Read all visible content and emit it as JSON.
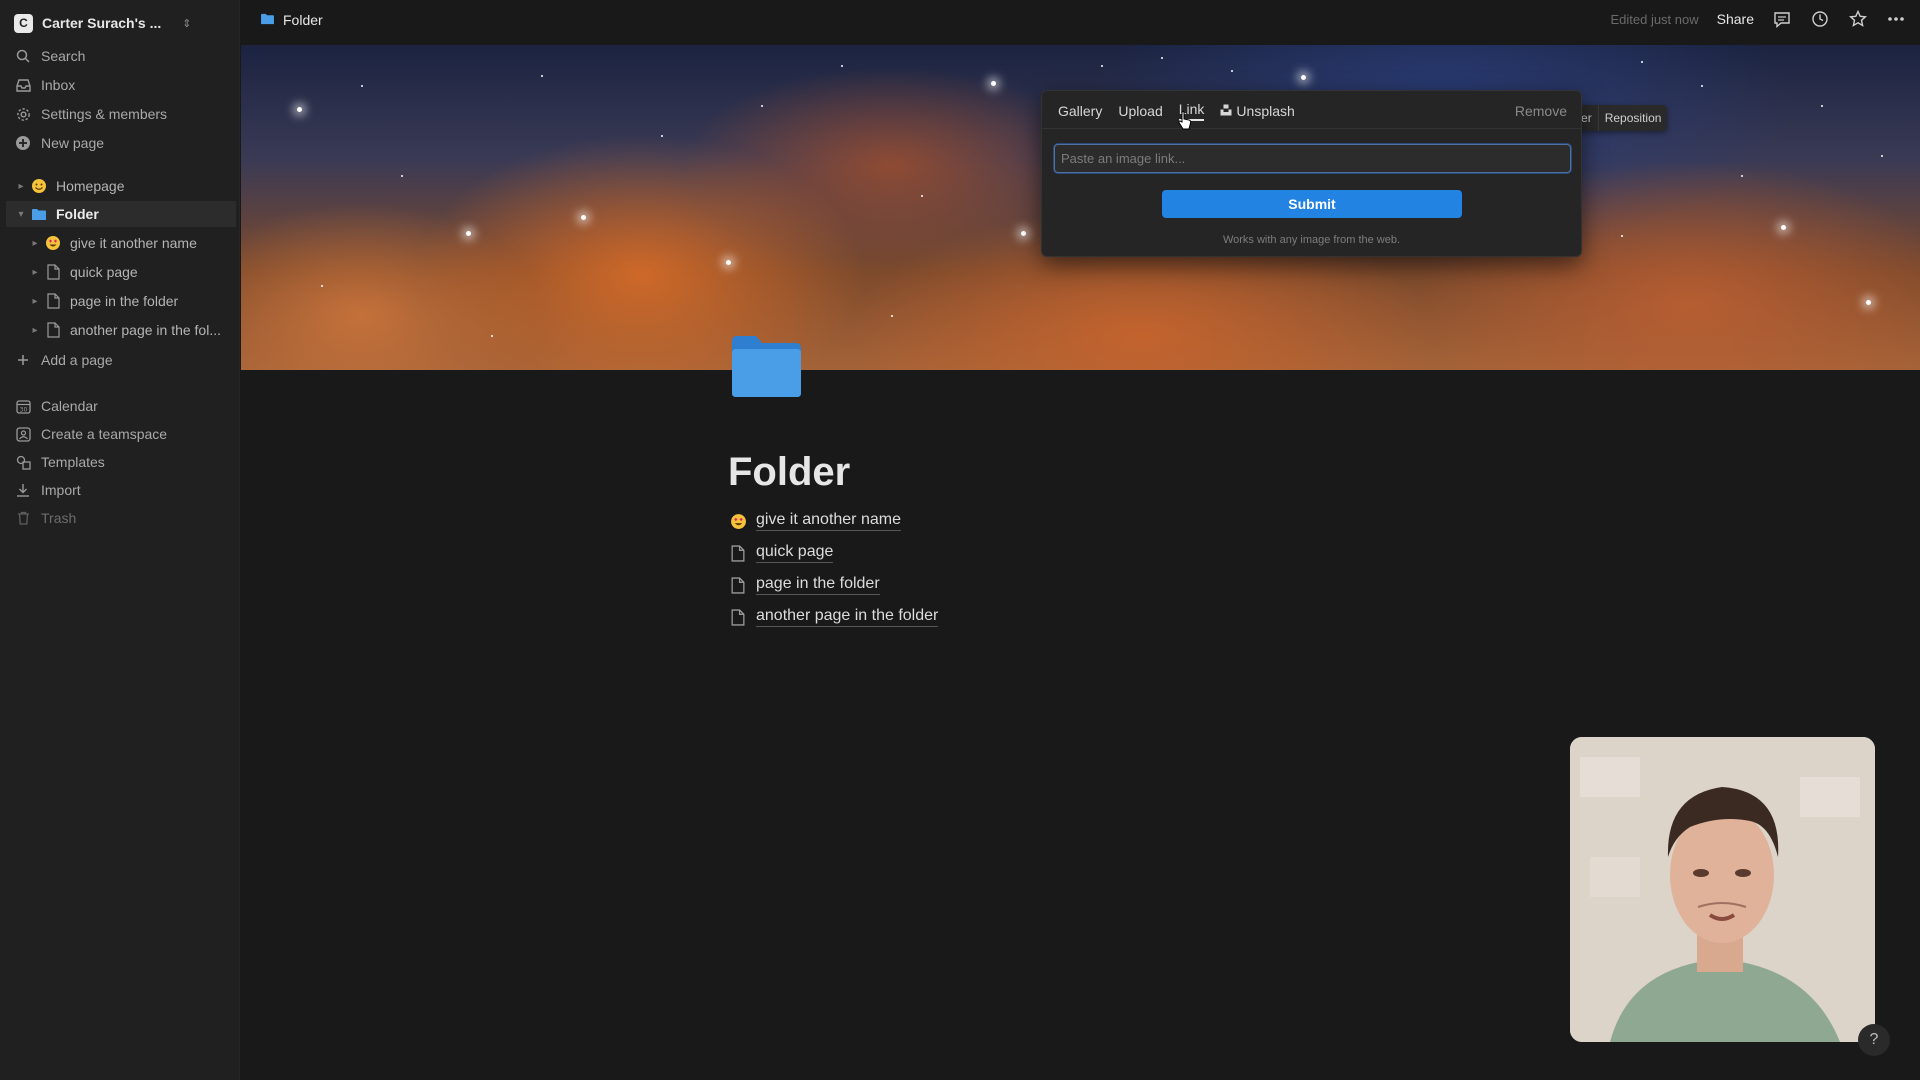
{
  "workspace": {
    "name": "Carter Surach's ...",
    "avatar_letter": "C"
  },
  "sidebar": {
    "top_items": [
      {
        "label": "Search",
        "icon": "search-icon"
      },
      {
        "label": "Inbox",
        "icon": "inbox-icon"
      },
      {
        "label": "Settings & members",
        "icon": "gear-icon"
      },
      {
        "label": "New page",
        "icon": "plus-circle-icon"
      }
    ],
    "tree": [
      {
        "label": "Homepage",
        "icon": "smiley-emoji"
      },
      {
        "label": "Folder",
        "icon": "folder-icon"
      },
      {
        "label": "give it another name",
        "icon": "heart-eyes-emoji"
      },
      {
        "label": "quick page",
        "icon": "page-icon"
      },
      {
        "label": "page in the folder",
        "icon": "page-icon"
      },
      {
        "label": "another page in the fol...",
        "icon": "page-icon"
      }
    ],
    "add_page": "Add a page",
    "bottom_items": [
      {
        "label": "Calendar",
        "icon": "calendar-icon"
      },
      {
        "label": "Create a teamspace",
        "icon": "teamspace-icon"
      },
      {
        "label": "Templates",
        "icon": "templates-icon"
      },
      {
        "label": "Import",
        "icon": "import-icon"
      },
      {
        "label": "Trash",
        "icon": "trash-icon"
      }
    ]
  },
  "topbar": {
    "breadcrumb": "Folder",
    "edited": "Edited just now",
    "share": "Share"
  },
  "cover": {
    "change_cover": "Change cover",
    "reposition": "Reposition"
  },
  "cover_popup": {
    "tabs": [
      "Gallery",
      "Upload",
      "Link",
      "Unsplash"
    ],
    "active_tab": "Link",
    "remove": "Remove",
    "link_placeholder": "Paste an image link...",
    "submit": "Submit",
    "hint": "Works with any image from the web."
  },
  "page": {
    "title": "Folder",
    "subpages": [
      {
        "label": "give it another name",
        "icon": "heart-eyes-emoji"
      },
      {
        "label": "quick page",
        "icon": "page-icon"
      },
      {
        "label": "page in the folder",
        "icon": "page-icon"
      },
      {
        "label": "another page in the folder",
        "icon": "page-icon"
      }
    ]
  },
  "help": "?",
  "colors": {
    "accent": "#2383e2",
    "background": "#191919",
    "sidebar": "#202020",
    "folder": "#4a9ee8"
  }
}
